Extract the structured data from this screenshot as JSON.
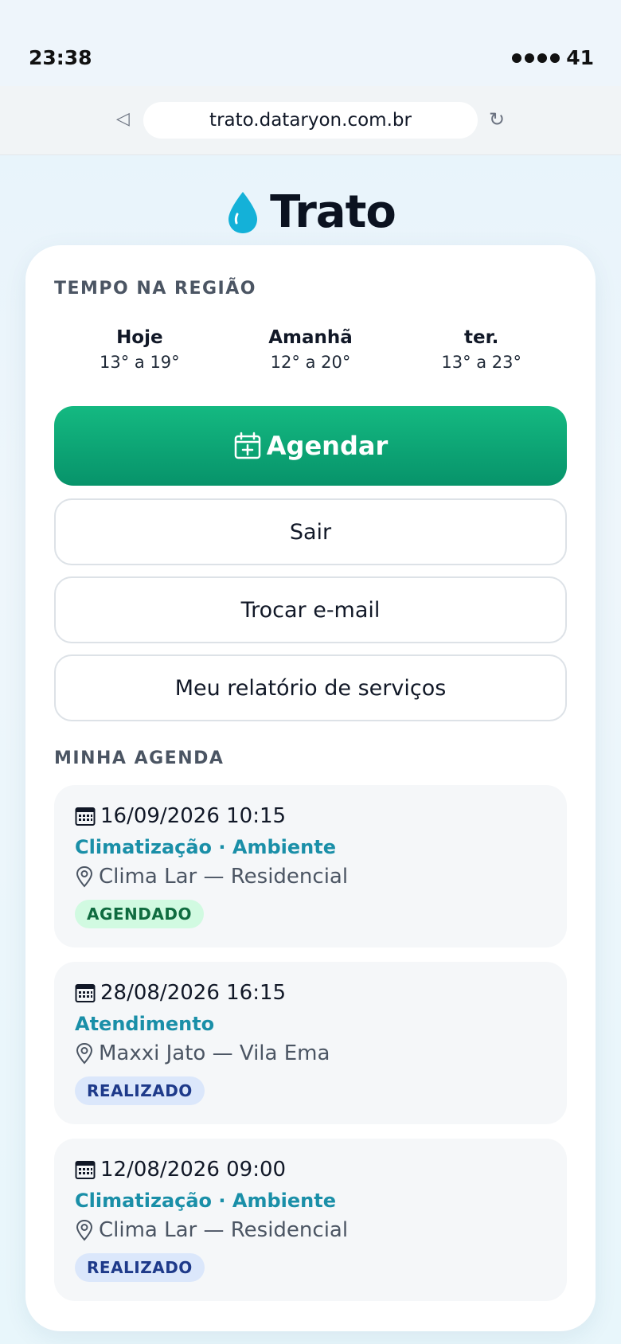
{
  "status_bar": {
    "time": "23:38",
    "signal": "41"
  },
  "browser": {
    "url": "trato.dataryon.com.br"
  },
  "brand": {
    "name": "Trato",
    "icon": "water-drop-icon",
    "color": "#1ab3d6"
  },
  "weather": {
    "title": "TEMPO NA REGIÃO",
    "days": [
      {
        "name": "Hoje",
        "range": "13° a 19°"
      },
      {
        "name": "Amanhã",
        "range": "12° a 20°"
      },
      {
        "name": "ter.",
        "range": "13° a 23°"
      }
    ]
  },
  "actions": {
    "schedule_label": "Agendar",
    "schedule_icon": "calendar-plus-icon",
    "schedule_color": "#10a874",
    "logout_label": "Sair",
    "change_email_label": "Trocar e-mail",
    "report_label": "Meu relatório de serviços"
  },
  "agenda": {
    "title": "MINHA AGENDA",
    "items": [
      {
        "datetime": "16/09/2026 10:15",
        "service": "Climatização · Ambiente",
        "place": "Clima Lar — Residencial",
        "status": "AGENDADO"
      },
      {
        "datetime": "28/08/2026 16:15",
        "service": "Atendimento",
        "place": "Maxxi Jato — Vila Ema",
        "status": "REALIZADO"
      },
      {
        "datetime": "12/08/2026 09:00",
        "service": "Climatização · Ambiente",
        "place": "Clima Lar — Residencial",
        "status": "REALIZADO"
      }
    ]
  }
}
